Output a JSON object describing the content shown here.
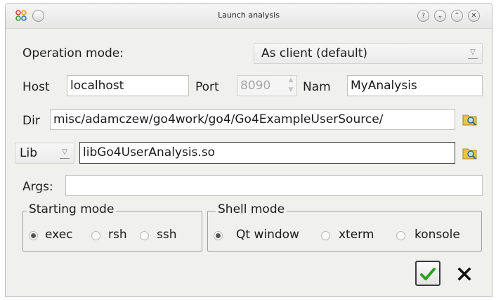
{
  "window": {
    "title": "Launch analysis",
    "titlebar_buttons": [
      "?",
      "⌄",
      "⌃",
      "✕"
    ]
  },
  "operation": {
    "label": "Operation mode:",
    "selected": "As client (default)"
  },
  "host": {
    "label": "Host",
    "value": "localhost",
    "port_label": "Port",
    "port_value": "8090",
    "name_label": "Nam",
    "name_value": "MyAnalysis"
  },
  "dir": {
    "label": "Dir",
    "value": "misc/adamczew/go4work/go4/Go4ExampleUserSource/"
  },
  "lib": {
    "type_selected": "Lib",
    "value": "libGo4UserAnalysis.so"
  },
  "args": {
    "label": "Args:",
    "value": ""
  },
  "starting_mode": {
    "title": "Starting mode",
    "options": [
      "exec",
      "rsh",
      "ssh"
    ],
    "selected": "exec"
  },
  "shell_mode": {
    "title": "Shell mode",
    "options": [
      "Qt window",
      "xterm",
      "konsole"
    ],
    "selected": "Qt window"
  },
  "colors": {
    "accept_green": "#2e9e1f",
    "cancel_black": "#111111"
  },
  "icons": {
    "app": "qt-app-icon",
    "folder": "folder-search-icon",
    "ok": "check-icon",
    "cancel": "close-icon"
  }
}
